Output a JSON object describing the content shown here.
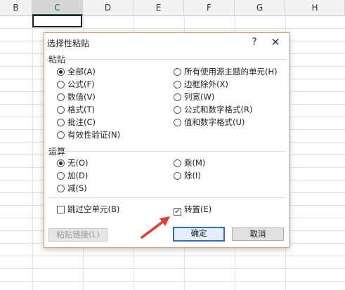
{
  "columns": [
    "B",
    "C",
    "D",
    "E",
    "F",
    "G",
    "H"
  ],
  "active_column": "C",
  "dialog": {
    "title": "选择性粘贴",
    "help": "?",
    "close": "✕",
    "paste_group": {
      "title": "粘贴",
      "left": [
        {
          "label": "全部(A)",
          "checked": true
        },
        {
          "label": "公式(F)",
          "checked": false
        },
        {
          "label": "数值(V)",
          "checked": false
        },
        {
          "label": "格式(T)",
          "checked": false
        },
        {
          "label": "批注(C)",
          "checked": false
        },
        {
          "label": "有效性验证(N)",
          "checked": false
        }
      ],
      "right": [
        {
          "label": "所有使用源主题的单元(H)",
          "checked": false
        },
        {
          "label": "边框除外(X)",
          "checked": false
        },
        {
          "label": "列宽(W)",
          "checked": false
        },
        {
          "label": "公式和数字格式(R)",
          "checked": false
        },
        {
          "label": "值和数字格式(U)",
          "checked": false
        }
      ]
    },
    "operation_group": {
      "title": "运算",
      "left": [
        {
          "label": "无(O)",
          "checked": true
        },
        {
          "label": "加(D)",
          "checked": false
        },
        {
          "label": "减(S)",
          "checked": false
        }
      ],
      "right": [
        {
          "label": "乘(M)",
          "checked": false
        },
        {
          "label": "除(I)",
          "checked": false
        }
      ]
    },
    "skip_blanks": {
      "label": "跳过空单元(B)",
      "checked": false
    },
    "transpose": {
      "label": "转置(E)",
      "checked": true
    },
    "paste_link_label": "粘贴链接(L)",
    "ok_label": "确定",
    "cancel_label": "取消"
  },
  "colors": {
    "arrow": "#e8392d",
    "active_column_text": "#1e7145",
    "default_button_border": "#2a6fc9"
  }
}
